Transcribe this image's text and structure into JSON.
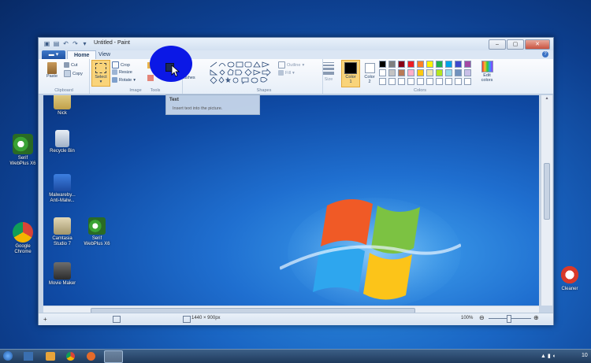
{
  "window": {
    "title": "Untitled - Paint",
    "file_tab": "",
    "tabs": [
      "Home",
      "View"
    ]
  },
  "ribbon": {
    "clipboard": {
      "paste": "Paste",
      "cut": "Cut",
      "copy": "Copy",
      "label": "Clipboard"
    },
    "image": {
      "select": "Select",
      "crop": "Crop",
      "resize": "Resize",
      "rotate": "Rotate",
      "label": "Image"
    },
    "tools": {
      "label": "Tools"
    },
    "brushes": {
      "label": "ushes"
    },
    "shapes": {
      "outline": "Outline",
      "fill": "Fill",
      "label": "Shapes"
    },
    "size": {
      "label": "Size"
    },
    "colors": {
      "color1": "Color",
      "color1_num": "1",
      "color2": "Color",
      "color2_num": "2",
      "edit": "Edit",
      "edit2": "colors",
      "label": "Colors",
      "palette_row1": [
        "#000000",
        "#7f7f7f",
        "#880015",
        "#ed1c24",
        "#ff7f27",
        "#fff200",
        "#22b14c",
        "#00a2e8",
        "#3f48cc",
        "#a349a4"
      ],
      "palette_row2": [
        "#ffffff",
        "#c3c3c3",
        "#b97a57",
        "#ffaec9",
        "#ffc90e",
        "#efe4b0",
        "#b5e61d",
        "#99d9ea",
        "#7092be",
        "#c8bfe7"
      ],
      "palette_row3": [
        "#ffffff",
        "#ffffff",
        "#ffffff",
        "#ffffff",
        "#ffffff",
        "#ffffff",
        "#ffffff",
        "#ffffff",
        "#ffffff",
        "#ffffff"
      ]
    }
  },
  "tooltip": {
    "title": "Text",
    "desc": "Insert text into the picture."
  },
  "status": {
    "dimensions": "1440 × 900px",
    "zoom": "100%"
  },
  "canvas_icons": [
    {
      "label1": "Nick",
      "label2": ""
    },
    {
      "label1": "Recycle Bin",
      "label2": ""
    },
    {
      "label1": "Malwareby...",
      "label2": "Anti-Malw..."
    },
    {
      "label1": "Camtasia",
      "label2": "Studio 7"
    },
    {
      "label1": "Serif",
      "label2": "WebPlus X6"
    },
    {
      "label1": "Movie Maker",
      "label2": ""
    }
  ],
  "desktop_icons": [
    {
      "label1": "Serif",
      "label2": "WebPlus X6"
    },
    {
      "label1": "Google",
      "label2": "Chrome"
    },
    {
      "label1": "Cleaner",
      "label2": ""
    }
  ],
  "taskbar": {
    "clock": "10"
  }
}
